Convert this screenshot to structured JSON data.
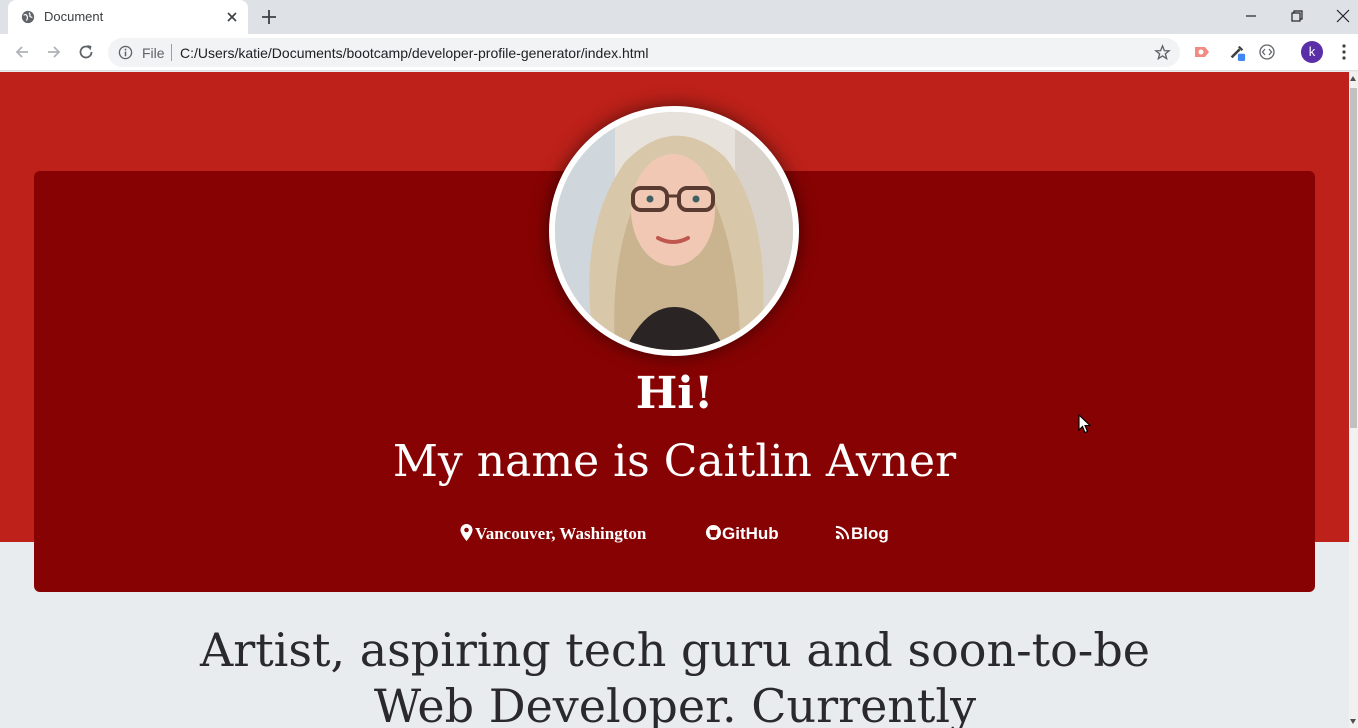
{
  "browser": {
    "tab_title": "Document",
    "address_scheme_label": "File",
    "url": "C:/Users/katie/Documents/bootcamp/developer-profile-generator/index.html",
    "profile_initial": "k"
  },
  "page": {
    "greeting": "Hi!",
    "name_line": "My name is Caitlin Avner",
    "links": {
      "location": "Vancouver, Washington",
      "github": "GitHub",
      "blog": "Blog"
    },
    "bio": "Artist, aspiring tech guru and soon-to-be Web Developer. Currently"
  },
  "colors": {
    "hero_band": "#bd2119",
    "card": "#870303",
    "page_background": "#e9ecee"
  },
  "icons": {
    "tab_favicon": "globe-icon",
    "location": "map-marker-icon",
    "github": "github-icon",
    "blog": "rss-icon"
  }
}
